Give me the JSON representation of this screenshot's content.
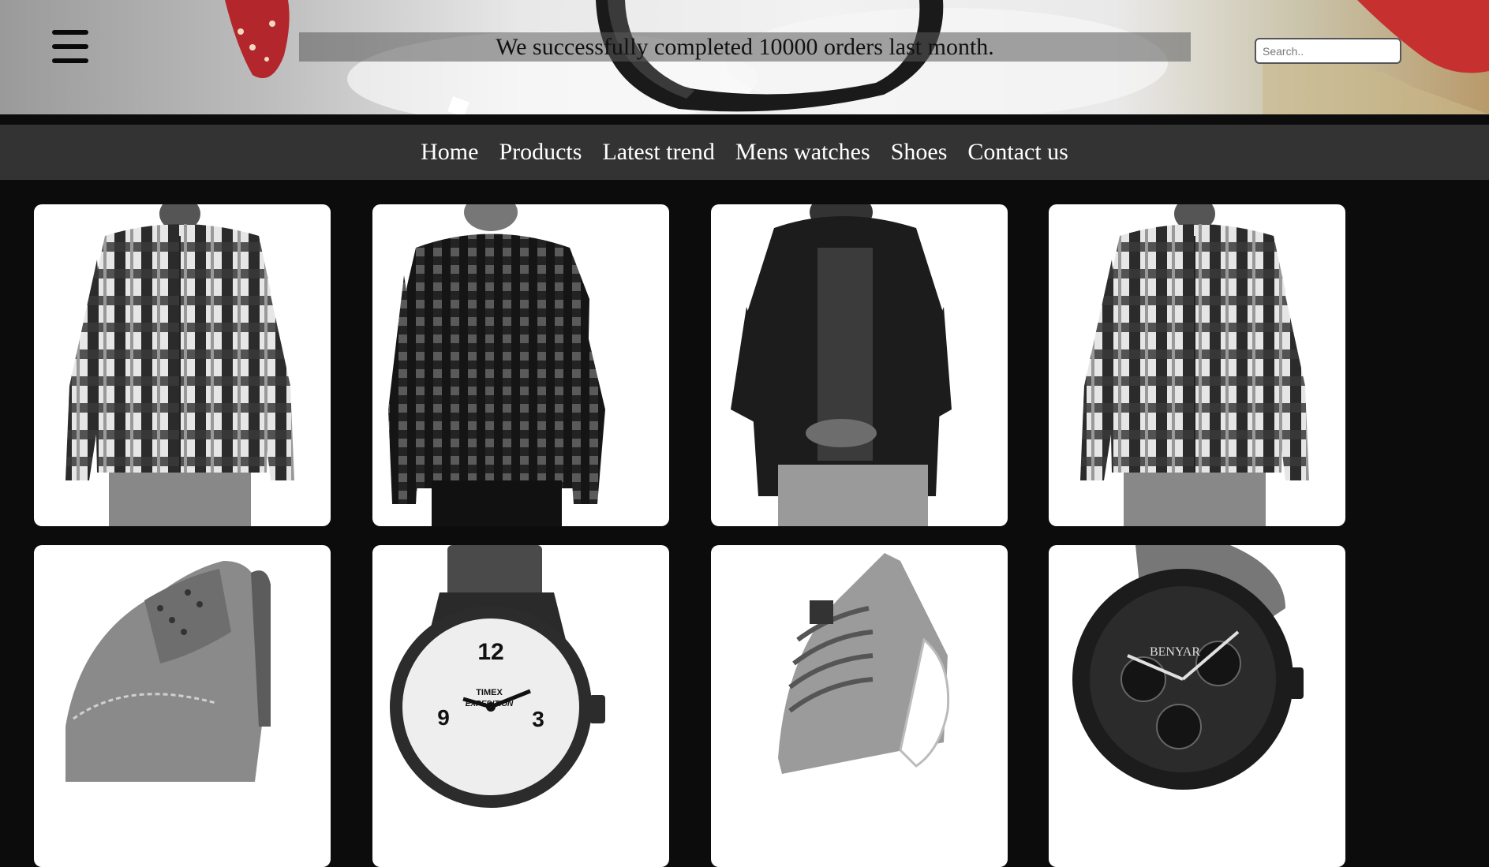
{
  "banner": {
    "menu_icon": "hamburger-menu-icon",
    "announcement": "We successfully completed 10000 orders last month.",
    "search_placeholder": "Search.."
  },
  "nav": {
    "items": [
      "Home",
      "Products",
      "Latest trend",
      "Mens watches",
      "Shoes",
      "Contact us"
    ]
  },
  "products": [
    {
      "image": "plaid-shirt-light"
    },
    {
      "image": "plaid-shirt-dark"
    },
    {
      "image": "black-overshirt"
    },
    {
      "image": "plaid-shirt-light"
    },
    {
      "image": "grey-shoe"
    },
    {
      "image": "timex-expedition-watch",
      "brand": "TIMEX",
      "model": "EXPEDITION"
    },
    {
      "image": "grey-knit-sneaker"
    },
    {
      "image": "benyar-chronograph-watch",
      "brand": "BENYAR"
    }
  ],
  "colors": {
    "page_bg": "#0c0c0c",
    "nav_bg": "#333333",
    "nav_text": "#ffffff",
    "card_bg": "#ffffff"
  }
}
